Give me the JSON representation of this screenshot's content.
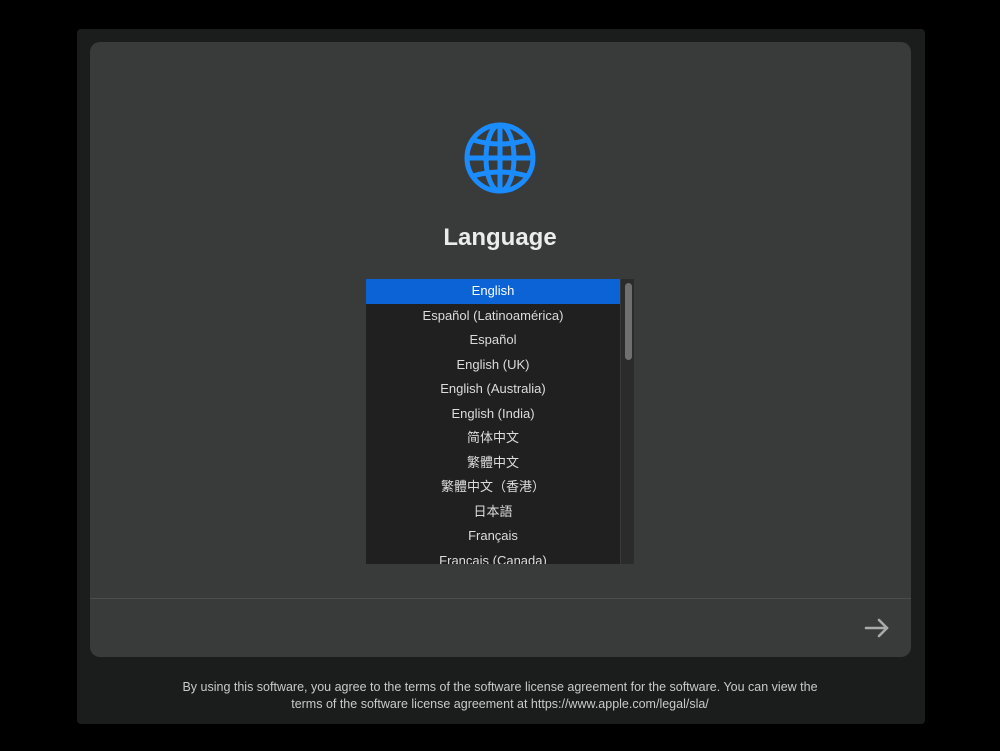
{
  "title": "Language",
  "icons": {
    "header": "globe-icon",
    "next": "arrow-right-icon"
  },
  "colors": {
    "accent": "#0b63d6",
    "globe": "#1a8cff"
  },
  "languages": {
    "selected": "English",
    "items": [
      "English",
      "Español (Latinoamérica)",
      "Español",
      "English (UK)",
      "English (Australia)",
      "English (India)",
      "简体中文",
      "繁體中文",
      "繁體中文（香港）",
      "日本語",
      "Français",
      "Français (Canada)"
    ]
  },
  "footer": {
    "line1": "By using this software, you agree to the terms of the software license agreement for the software. You can view the",
    "line2": "terms of the software license agreement at https://www.apple.com/legal/sla/"
  }
}
